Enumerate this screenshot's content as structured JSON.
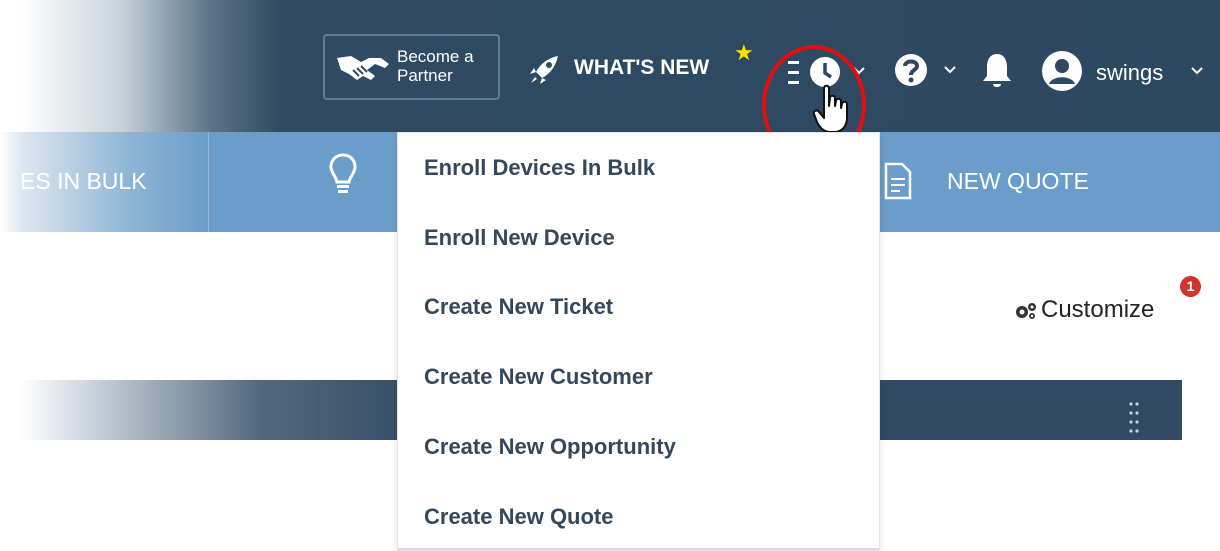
{
  "header": {
    "partner_line1": "Become a",
    "partner_line2": "Partner",
    "whats_new": "WHAT'S NEW",
    "user_name": "swings"
  },
  "subbar": {
    "bulk_partial": "ES IN BULK",
    "new_quote": "NEW QUOTE"
  },
  "dropdown": {
    "items": [
      "Enroll Devices In Bulk",
      "Enroll New Device",
      "Create New Ticket",
      "Create New Customer",
      "Create New Opportunity",
      "Create New Quote"
    ]
  },
  "customize": {
    "label": "Customize",
    "badge": "1"
  },
  "colors": {
    "header_bg": "#2d4861",
    "subbar_bg": "#6a9dc9",
    "highlight_circle": "#e10f0f",
    "badge": "#d0342c",
    "star": "#ffe100"
  }
}
